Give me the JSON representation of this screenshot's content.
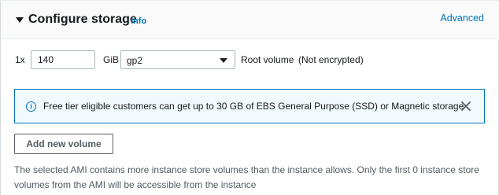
{
  "section": {
    "title": "Configure storage",
    "info_link": "Info",
    "advanced_link": "Advanced"
  },
  "volume": {
    "count_prefix": "1x",
    "size_value": "140",
    "size_unit": "GiB",
    "type_selected": "gp2",
    "root_label": "Root volume",
    "encryption_note": "(Not encrypted)"
  },
  "alert": {
    "icon": "info-circle-icon",
    "text": "Free tier eligible customers can get up to 30 GB of EBS General Purpose (SSD) or Magnetic storage",
    "close_icon": "close-icon",
    "accent_color": "#0073bb",
    "background_color": "#f1faff"
  },
  "actions": {
    "add_volume_label": "Add new volume"
  },
  "footnote": "The selected AMI contains more instance store volumes than the instance allows. Only the first 0 instance store volumes from the AMI will be accessible from the instance"
}
